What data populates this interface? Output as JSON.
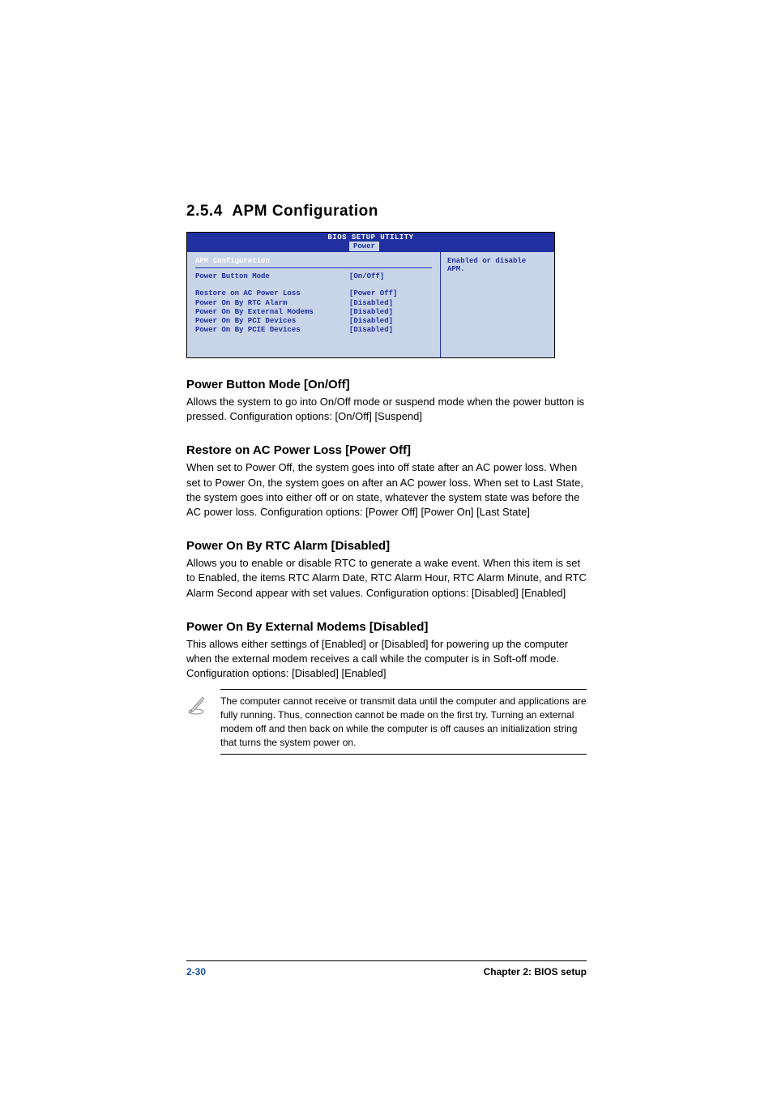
{
  "section": {
    "number": "2.5.4",
    "title": "APM Configuration"
  },
  "bios": {
    "header": "BIOS SETUP UTILITY",
    "tab": "Power",
    "panel_title": "APM Configuration",
    "help_text": "Enabled or disable APM.",
    "items": [
      {
        "label": "Power Button Mode",
        "value": "[On/Off]"
      }
    ],
    "items2": [
      {
        "label": "Restore on AC Power Loss",
        "value": "[Power Off]"
      },
      {
        "label": "Power On By RTC Alarm",
        "value": "[Disabled]"
      },
      {
        "label": "Power On By External Modems",
        "value": "[Disabled]"
      },
      {
        "label": "Power On By PCI Devices",
        "value": "[Disabled]"
      },
      {
        "label": "Power On By PCIE Devices",
        "value": "[Disabled]"
      }
    ]
  },
  "descriptions": [
    {
      "title": "Power Button Mode [On/Off]",
      "text": "Allows the system to go into On/Off mode or suspend mode when the power button is pressed. Configuration options: [On/Off] [Suspend]"
    },
    {
      "title": "Restore on AC Power Loss [Power Off]",
      "text": "When set to Power Off, the system goes into off state after an AC power loss. When set to Power On, the system goes on after an AC power loss. When set to Last State, the system goes into either off or on state, whatever the system state was before the AC power loss. Configuration options: [Power Off] [Power On] [Last State]"
    },
    {
      "title": "Power On By RTC Alarm [Disabled]",
      "text": "Allows you to enable or disable RTC to generate a wake event. When this item is set to Enabled, the items RTC Alarm Date, RTC Alarm Hour, RTC Alarm Minute, and RTC Alarm Second appear with set values. Configuration options: [Disabled] [Enabled]"
    },
    {
      "title": "Power On By External Modems [Disabled]",
      "text": "This allows either settings of [Enabled] or [Disabled] for powering up the computer when the external modem receives a call while the computer is in Soft-off mode. Configuration options: [Disabled] [Enabled]"
    }
  ],
  "note": "The computer cannot receive or transmit data until the computer and applications are fully running. Thus, connection cannot be made on the first try. Turning an external modem off and then back on while the computer is off causes an initialization string that turns the system power on.",
  "footer": {
    "page": "2-30",
    "chapter": "Chapter 2: BIOS setup"
  }
}
